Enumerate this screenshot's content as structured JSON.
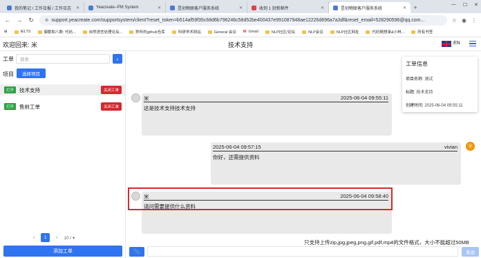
{
  "browser": {
    "tabs": [
      {
        "title": "我的笔记 / 工作日报 / 工作日志"
      },
      {
        "title": "Yeacreate--PM System"
      },
      {
        "title": "昱创物联客户服务系统"
      },
      {
        "title": "收到 1 封新邮件"
      },
      {
        "title": "昱创物联客户服务系统"
      }
    ],
    "url": "support.yeacreate.com/supportsystem/client?reset_token=b514af59f35c68d6b796246c58d52be400437e991087948ae12226d696a7a3df&reset_email=528290596@qq.com...",
    "bookmarks": [
      "IELTS",
      "御郡和八数: 代码...",
      "自然语言处理论坛...",
      "聆听的github仓库",
      "科研学术网站",
      "General 会议",
      "Gmail",
      "NLP社区/论坛",
      "NLP会议",
      "NLP社区网址",
      "代码随想录&小林...",
      "所有书签"
    ]
  },
  "header": {
    "welcome": "欢迎回来: 米",
    "title": "技术支持",
    "lang": "EN"
  },
  "sidebar": {
    "ticket_label": "工单",
    "search_placeholder": "搜索",
    "search_btn": "‹",
    "project_label": "项目",
    "select_project": "选择项目",
    "tickets": [
      {
        "status": "打开",
        "name": "技术支持",
        "close": "关闭工单"
      },
      {
        "status": "打开",
        "name": "售前工单",
        "close": "关闭工单"
      }
    ],
    "pagination": {
      "prev": "‹",
      "page": "1",
      "next": "›",
      "size": "10 / ▾"
    },
    "add_ticket": "添加工单"
  },
  "messages": [
    {
      "sender": "米",
      "time": "2025-06-04 09:55:11",
      "text": "这是技术支持技术支持"
    },
    {
      "sender": "vivian",
      "time": "2025-06-04 09:57:15",
      "text": "你好，还需提供资料",
      "avatar_letter": "V"
    },
    {
      "sender": "米",
      "time": "2025-06-04 09:58:40",
      "text": "请问需要提供什么资料"
    }
  ],
  "ticket_info": {
    "title": "工单信息",
    "project_label": "项目名称:",
    "project_value": "测试",
    "subject_label": "标题:",
    "subject_value": "技术支持",
    "created_label": "创建时间:",
    "created_value": "2025-06-04 09:55:11"
  },
  "composer": {
    "hint": "只支持上传zip,jpg,jpeg,png,gif,pdf,mp4的文件格式，大小不能超过50MB",
    "attach_icon": "📎",
    "send": "发送"
  },
  "colors": {
    "primary": "#2f74f0",
    "danger": "#d6282f",
    "success": "#2ea043",
    "highlight": "#d62a2a"
  }
}
